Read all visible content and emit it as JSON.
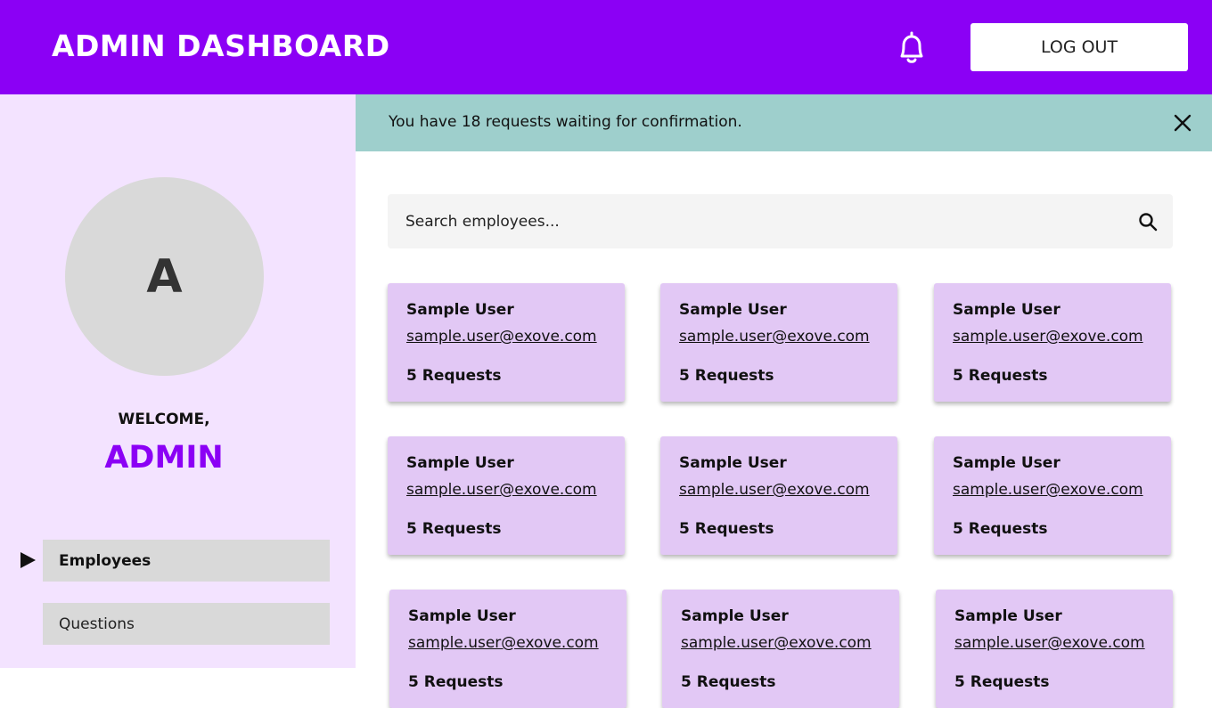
{
  "header": {
    "title": "ADMIN DASHBOARD",
    "logout_label": "LOG OUT",
    "accent_color": "#8b00f5"
  },
  "sidebar": {
    "avatar_initial": "A",
    "welcome": "WELCOME,",
    "admin_name": "ADMIN",
    "nav_items": [
      {
        "label": "Employees",
        "active": true
      },
      {
        "label": "Questions",
        "active": false
      }
    ]
  },
  "banner": {
    "message": "You have 18 requests waiting for confirmation.",
    "color": "#9ecfcc"
  },
  "search": {
    "placeholder": "Search employees..."
  },
  "employees": [
    {
      "name": "Sample User",
      "email": "sample.user@exove.com",
      "requests": "5 Requests"
    },
    {
      "name": "Sample User",
      "email": "sample.user@exove.com",
      "requests": "5 Requests"
    },
    {
      "name": "Sample User",
      "email": "sample.user@exove.com",
      "requests": "5 Requests"
    },
    {
      "name": "Sample User",
      "email": "sample.user@exove.com",
      "requests": "5 Requests"
    },
    {
      "name": "Sample User",
      "email": "sample.user@exove.com",
      "requests": "5 Requests"
    },
    {
      "name": "Sample User",
      "email": "sample.user@exove.com",
      "requests": "5 Requests"
    },
    {
      "name": "Sample User",
      "email": "sample.user@exove.com",
      "requests": "5 Requests"
    },
    {
      "name": "Sample User",
      "email": "sample.user@exove.com",
      "requests": "5 Requests"
    },
    {
      "name": "Sample User",
      "email": "sample.user@exove.com",
      "requests": "5 Requests"
    }
  ]
}
